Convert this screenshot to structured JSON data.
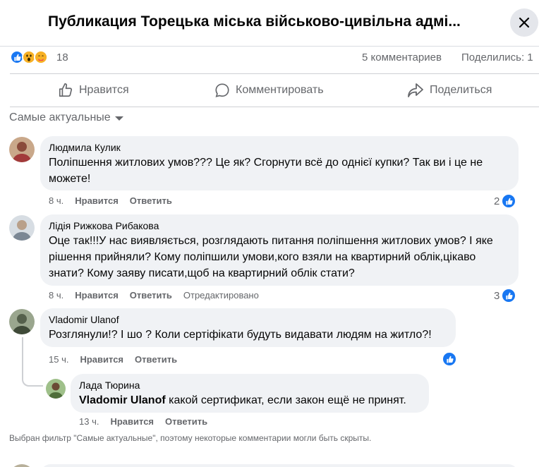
{
  "header": {
    "title": "Публикация Торецька міська військово-цивільна адмі..."
  },
  "stats": {
    "reaction_icons": [
      "like-icon",
      "wow-icon",
      "care-icon"
    ],
    "reaction_count": "18",
    "comments": "5 комментариев",
    "shares": "Поделились: 1"
  },
  "actions": {
    "like": "Нравится",
    "comment": "Комментировать",
    "share": "Поделиться"
  },
  "filter": {
    "label": "Самые актуальные"
  },
  "comments": [
    {
      "author": "Людмила Кулик",
      "text": "Поліпшення житлових умов??? Це як? Сгорнути всё до однієї купки? Так ви і це не можете!",
      "time": "8 ч.",
      "like_action": "Нравится",
      "reply_action": "Ответить",
      "likes": "2"
    },
    {
      "author": "Лідія Рижкова Рибакова",
      "text": "Оце так!!!У нас виявляється, розглядають питання поліпшення житлових умов? І яке рішення прийняли? Кому поліпшили умови,кого взяли на квартирний облік,цікаво знати? Кому заяву писати,щоб на квартирний облік стати?",
      "time": "8 ч.",
      "like_action": "Нравится",
      "reply_action": "Ответить",
      "edited": "Отредактировано",
      "likes": "3"
    },
    {
      "author": "Vladomir Ulanof",
      "text": "Розглянули!? І шо ? Коли сертіфікати будуть видавати людям на житло?!",
      "time": "15 ч.",
      "like_action": "Нравится",
      "reply_action": "Ответить"
    }
  ],
  "reply": {
    "author": "Лада Тюрина",
    "mention": "Vladomir Ulanof",
    "text": " какой сертификат, если закон ещё не принят.",
    "time": "13 ч.",
    "like_action": "Нравится",
    "reply_action": "Ответить"
  },
  "footnote": "Выбран фильтр \"Самые актуальные\", поэтому некоторые комментарии могли быть скрыты.",
  "colors": {
    "accent": "#1877f2",
    "secondary_text": "#65676b",
    "bubble": "#f0f2f5"
  }
}
